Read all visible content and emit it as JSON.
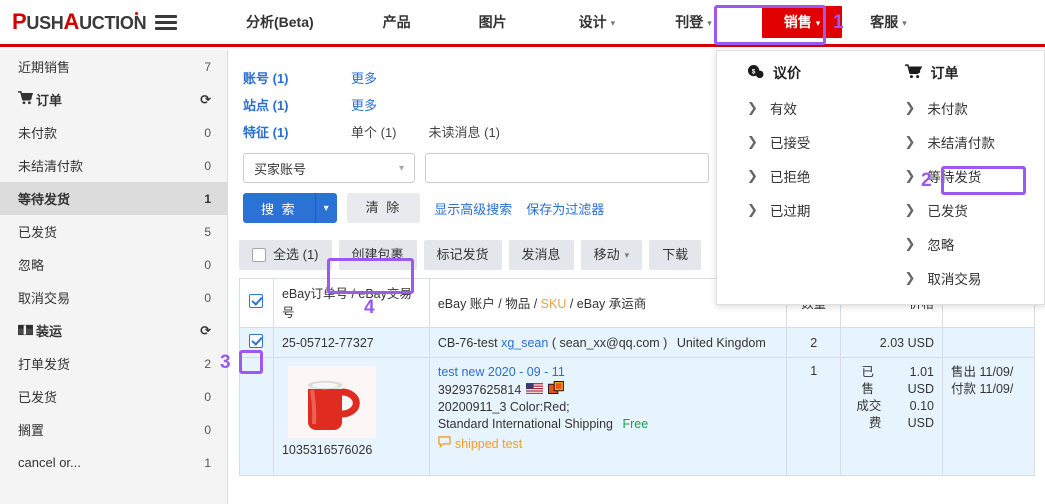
{
  "brand": {
    "part1": "P",
    "part2": "USH",
    "part3": "A",
    "part4": "UCTION",
    "menu_icon": "hamburger-icon"
  },
  "topnav": {
    "items": [
      {
        "label": "分析(Beta)",
        "caret": false
      },
      {
        "label": "产品",
        "caret": false
      },
      {
        "label": "图片",
        "caret": false
      },
      {
        "label": "设计",
        "caret": true
      },
      {
        "label": "刊登",
        "caret": true
      },
      {
        "label": "销售",
        "caret": true,
        "active": true
      },
      {
        "label": "客服",
        "caret": true
      }
    ],
    "active_color": "#e00000",
    "accent_bar_color": "#d40000"
  },
  "annotations": [
    {
      "number": "1",
      "target": "sales-nav-tab"
    },
    {
      "number": "2",
      "target": "dropdown-awaiting-shipment"
    },
    {
      "number": "3",
      "target": "row-select-checkbox"
    },
    {
      "number": "4",
      "target": "create-package-button"
    }
  ],
  "annotation_color": "#9b59f0",
  "sidebar": {
    "items": [
      {
        "label": "近期销售",
        "count": "7",
        "icon": null,
        "selected": false,
        "group": false
      },
      {
        "label": "订单",
        "count": "refresh-icon",
        "icon": "cart-icon",
        "selected": false,
        "group": true
      },
      {
        "label": "未付款",
        "count": "0",
        "icon": null,
        "selected": false,
        "group": false
      },
      {
        "label": "未结清付款",
        "count": "0",
        "icon": null,
        "selected": false,
        "group": false
      },
      {
        "label": "等待发货",
        "count": "1",
        "icon": null,
        "selected": true,
        "group": false
      },
      {
        "label": "已发货",
        "count": "5",
        "icon": null,
        "selected": false,
        "group": false
      },
      {
        "label": "忽略",
        "count": "0",
        "icon": null,
        "selected": false,
        "group": false
      },
      {
        "label": "取消交易",
        "count": "0",
        "icon": null,
        "selected": false,
        "group": false
      },
      {
        "label": "装运",
        "count": "refresh-icon",
        "icon": "box-icon",
        "selected": false,
        "group": true
      },
      {
        "label": "打单发货",
        "count": "2",
        "icon": null,
        "selected": false,
        "group": false
      },
      {
        "label": "已发货",
        "count": "0",
        "icon": null,
        "selected": false,
        "group": false
      },
      {
        "label": "搁置",
        "count": "0",
        "icon": null,
        "selected": false,
        "group": false
      },
      {
        "label": "cancel or...",
        "count": "1",
        "icon": null,
        "selected": false,
        "group": false
      }
    ]
  },
  "filters": {
    "rows": [
      {
        "label": "账号 (1)",
        "links": [
          "更多"
        ],
        "texts": []
      },
      {
        "label": "站点 (1)",
        "links": [
          "更多"
        ],
        "texts": []
      },
      {
        "label": "特征 (1)",
        "links": [],
        "texts": [
          "单个 (1)",
          "未读消息 (1)"
        ]
      }
    ],
    "select_value": "买家账号",
    "input_value": "",
    "input_placeholder": "",
    "search_label": "搜 索",
    "clear_label": "清 除",
    "advanced_link": "显示高级搜索",
    "save_filter_link": "保存为过滤器"
  },
  "toolbar": {
    "select_all_label": "全选 (1)",
    "select_all_checked": false,
    "buttons": [
      {
        "label": "创建包裹",
        "caret": false,
        "highlighted": true
      },
      {
        "label": "标记发货",
        "caret": false,
        "highlighted": false
      },
      {
        "label": "发消息",
        "caret": false,
        "highlighted": false
      },
      {
        "label": "移动",
        "caret": true,
        "highlighted": false
      },
      {
        "label": "下载",
        "caret": false,
        "highlighted": false
      }
    ]
  },
  "table": {
    "header_checked": true,
    "columns": [
      {
        "key": "chk",
        "label": ""
      },
      {
        "key": "order",
        "label": "eBay订单号 / eBay交易号"
      },
      {
        "key": "item",
        "label_pre": "eBay 账户 / 物品 / ",
        "label_hl": "SKU",
        "label_post": " / eBay 承运商"
      },
      {
        "key": "qty",
        "label": "数量"
      },
      {
        "key": "price",
        "label": "价格"
      },
      {
        "key": "date",
        "label": ""
      }
    ],
    "order_row": {
      "checked": true,
      "order_number": "25-05712-77327",
      "account": "CB-76-test",
      "buyer_id": "xg_sean",
      "buyer_email": "( sean_xx@qq.com )",
      "country": "United Kingdom",
      "qty": "2",
      "price": "2.03 USD"
    },
    "item_row": {
      "transaction_id": "1035316576026",
      "product_image": "red-mug-photo",
      "title": "test new 2020 - 09 - 11",
      "item_number": "392937625814",
      "flag_icon": "us-flag-icon",
      "variation_icon": "multi-variation-icon",
      "sku_line": "20200911_3 Color:Red;",
      "shipping_service": "Standard International Shipping",
      "shipping_cost": "Free",
      "note_icon": "message-icon",
      "note_text": "shipped test",
      "qty": "1",
      "price_lines": [
        {
          "label": "已售",
          "value": "1.01 USD"
        },
        {
          "label": "成交费",
          "value": "0.10 USD"
        }
      ],
      "date_lines": [
        {
          "label": "售出",
          "value": "11/09/"
        },
        {
          "label": "付款",
          "value": "11/09/"
        }
      ]
    }
  },
  "dropdown": {
    "left": {
      "icon": "negotiation-icon",
      "title": "议价",
      "items": [
        "有效",
        "已接受",
        "已拒绝",
        "已过期"
      ]
    },
    "right": {
      "icon": "cart-icon",
      "title": "订单",
      "items": [
        "未付款",
        "未结清付款",
        "等待发货",
        "已发货",
        "忽略",
        "取消交易"
      ],
      "highlighted_item": "等待发货"
    }
  }
}
